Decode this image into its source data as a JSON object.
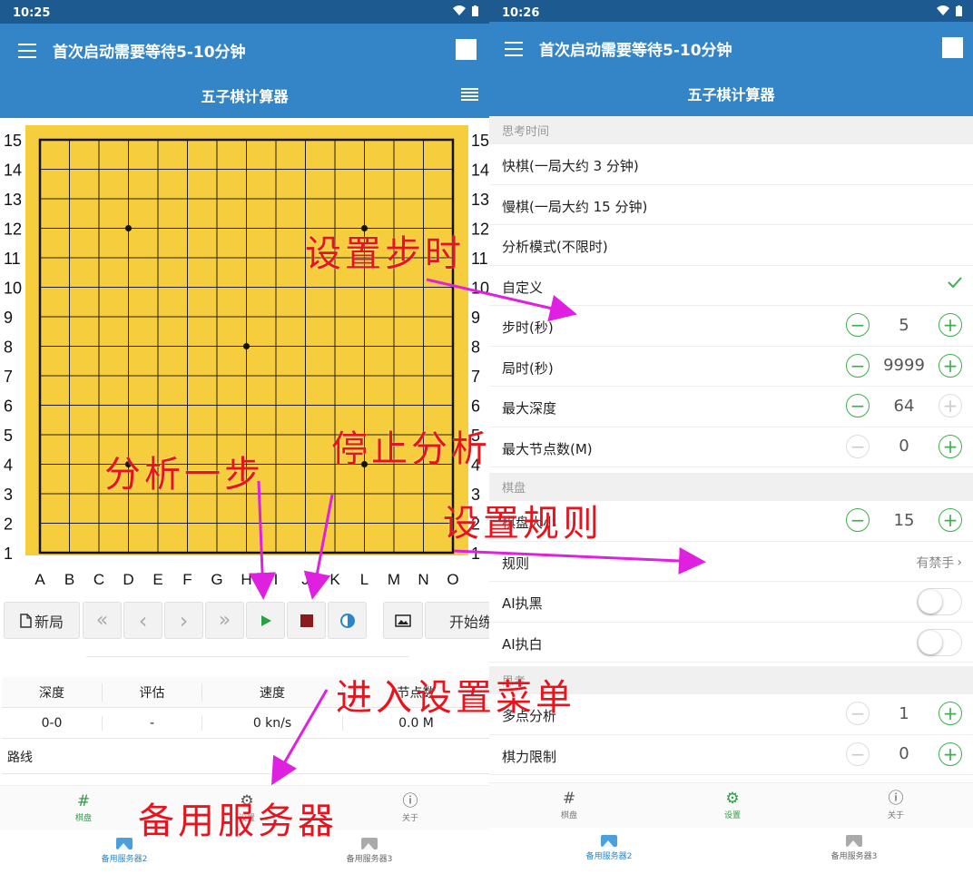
{
  "left": {
    "status_time": "10:25",
    "appbar_title": "首次启动需要等待5-10分钟",
    "subtitle": "五子棋计算器",
    "board": {
      "row_labels": [
        "15",
        "14",
        "13",
        "12",
        "11",
        "10",
        "9",
        "8",
        "7",
        "6",
        "5",
        "4",
        "3",
        "2",
        "1"
      ],
      "col_labels": [
        "A",
        "B",
        "C",
        "D",
        "E",
        "F",
        "G",
        "H",
        "I",
        "J",
        "K",
        "L",
        "M",
        "N",
        "O"
      ],
      "star_points": [
        [
          "D",
          12
        ],
        [
          "L",
          12
        ],
        [
          "H",
          8
        ],
        [
          "D",
          4
        ],
        [
          "L",
          4
        ]
      ]
    },
    "toolbar": {
      "new_game": "新局",
      "first": "«",
      "prev": "‹",
      "next": "›",
      "last": "»",
      "start_label": "开始练"
    },
    "stats": {
      "headers": [
        "深度",
        "评估",
        "速度",
        "节点数"
      ],
      "values": [
        "0-0",
        "-",
        "0 kn/s",
        "0.0 M"
      ]
    },
    "route_label": "路线",
    "nav": {
      "board": "棋盘",
      "settings": "设置",
      "about": "关于"
    },
    "servers": [
      "备用服务器2",
      "备用服务器3"
    ]
  },
  "right": {
    "status_time": "10:26",
    "appbar_title": "首次启动需要等待5-10分钟",
    "subtitle": "五子棋计算器",
    "sections": {
      "think_time": "思考时间",
      "board": "棋盘",
      "think": "思考"
    },
    "time_options": [
      "快棋(一局大约 3 分钟)",
      "慢棋(一局大约 15 分钟)",
      "分析模式(不限时)",
      "自定义"
    ],
    "steppers": {
      "step_time": {
        "label": "步时(秒)",
        "value": "5"
      },
      "game_time": {
        "label": "局时(秒)",
        "value": "9999"
      },
      "max_depth": {
        "label": "最大深度",
        "value": "64"
      },
      "max_nodes": {
        "label": "最大节点数(M)",
        "value": "0"
      },
      "board_size": {
        "label": "棋盘大小",
        "value": "15"
      },
      "multi_pv": {
        "label": "多点分析",
        "value": "1"
      },
      "strength": {
        "label": "棋力限制",
        "value": "0"
      }
    },
    "rule": {
      "label": "规则",
      "value": "有禁手"
    },
    "ai_black": "AI执黑",
    "ai_white": "AI执白",
    "nav": {
      "board": "棋盘",
      "settings": "设置",
      "about": "关于"
    },
    "servers": [
      "备用服务器2",
      "备用服务器3"
    ]
  },
  "annotations": {
    "step_time": "设置步时",
    "analyze_one": "分析一步",
    "stop_analysis": "停止分析",
    "set_rules": "设置规则",
    "enter_settings": "进入设置菜单",
    "backup_server": "备用服务器"
  },
  "colors": {
    "appbar": "#3385c7",
    "statusbar": "#1d5a8f",
    "board": "#f5cd3d",
    "accent_green": "#3bb04d",
    "annotation_red": "#e8131c",
    "arrow_magenta": "#e020e0"
  }
}
